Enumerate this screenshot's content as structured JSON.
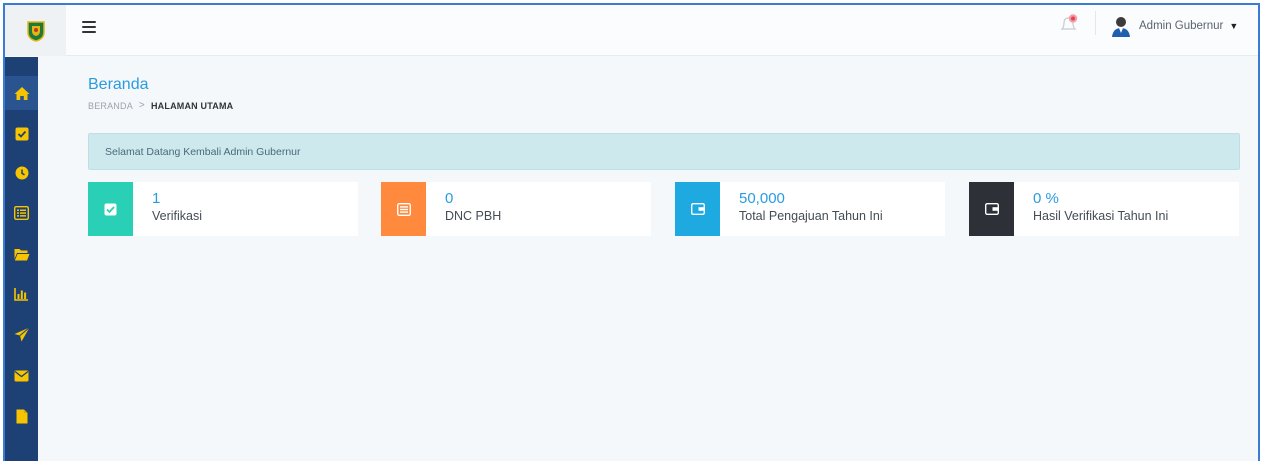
{
  "header": {
    "user_name": "Admin Gubernur"
  },
  "page": {
    "title": "Beranda",
    "breadcrumb": {
      "root": "BERANDA",
      "separator": ">",
      "current": "HALAMAN UTAMA"
    }
  },
  "alert": {
    "message": "Selamat Datang Kembali Admin Gubernur"
  },
  "cards": [
    {
      "value": "1",
      "label": "Verifikasi",
      "color": "#2ad0b5",
      "icon": "check-square-icon"
    },
    {
      "value": "0",
      "label": "DNC PBH",
      "color": "#ff8a3d",
      "icon": "list-icon"
    },
    {
      "value": "50,000",
      "label": "Total Pengajuan Tahun Ini",
      "color": "#1fa9e1",
      "icon": "wallet-icon"
    },
    {
      "value": "0 %",
      "label": "Hasil Verifikasi Tahun Ini",
      "color": "#2d3036",
      "icon": "wallet-icon"
    }
  ],
  "sidebar": {
    "items": [
      {
        "icon": "home-icon"
      },
      {
        "icon": "check-square-icon"
      },
      {
        "icon": "clock-icon"
      },
      {
        "icon": "list-icon"
      },
      {
        "icon": "folder-open-icon"
      },
      {
        "icon": "bar-chart-icon"
      },
      {
        "icon": "send-icon"
      },
      {
        "icon": "envelope-icon"
      },
      {
        "icon": "file-icon"
      }
    ]
  },
  "colors": {
    "sidebar_bg": "#1d4075",
    "sidebar_icon": "#f6c400",
    "accent_blue": "#2b9be0",
    "alert_bg": "#cde9ee"
  }
}
